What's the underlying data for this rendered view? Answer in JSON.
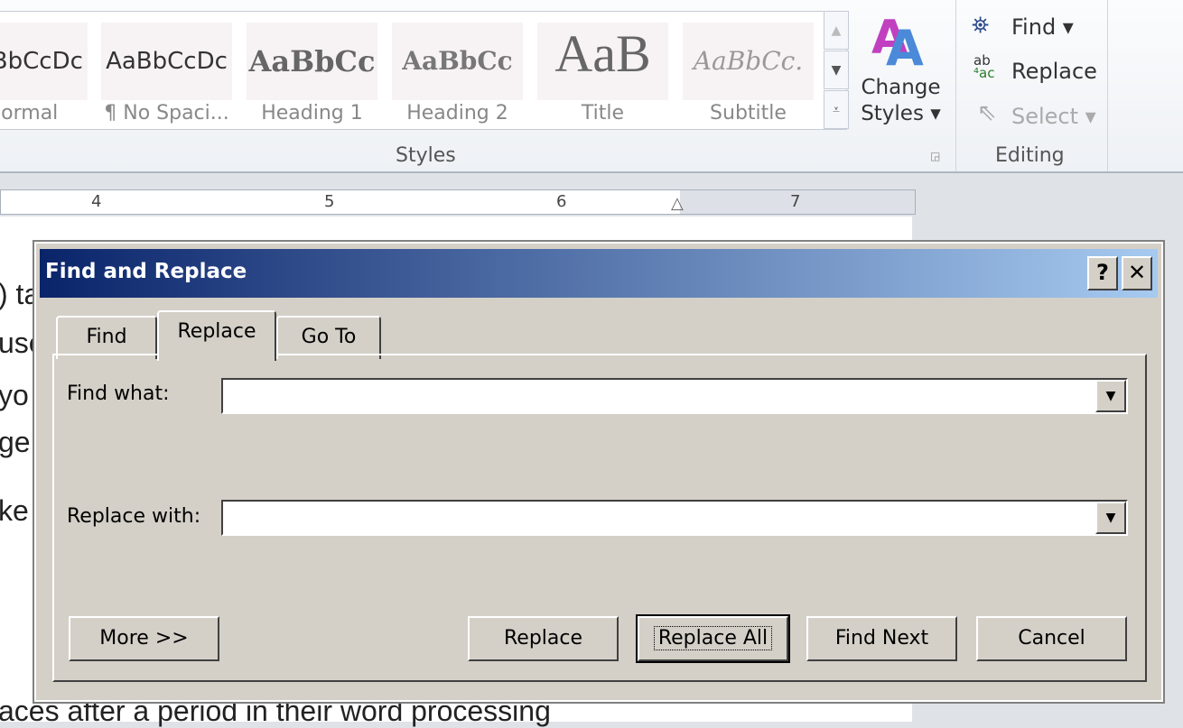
{
  "ribbon": {
    "styles": [
      {
        "preview": "AaBbCcDc",
        "name": "Normal"
      },
      {
        "preview": "AaBbCcDc",
        "name": "¶ No Spaci..."
      },
      {
        "preview": "AaBbCc",
        "name": "Heading 1"
      },
      {
        "preview": "AaBbCc",
        "name": "Heading 2"
      },
      {
        "preview": "AaB",
        "name": "Title"
      },
      {
        "preview": "AaBbCc.",
        "name": "Subtitle"
      }
    ],
    "styles_group": "Styles",
    "change_styles": [
      "Change",
      "Styles ▾"
    ],
    "editing": {
      "find": "Find ▾",
      "replace": "Replace",
      "select": "Select ▾",
      "group": "Editing"
    }
  },
  "ruler": {
    "numbers": [
      "4",
      "5",
      "6",
      "7"
    ]
  },
  "document": {
    "fragments": [
      ") ta",
      "use",
      "yo",
      "ge",
      "ke",
      "aces after a period in their word processing"
    ]
  },
  "dialog": {
    "title": "Find and Replace",
    "help": "?",
    "close": "✕",
    "tabs": [
      {
        "label": "Find"
      },
      {
        "label": "Replace",
        "active": true
      },
      {
        "label": "Go To"
      }
    ],
    "find_what_label": "Find what:",
    "find_what_value": "",
    "replace_with_label": "Replace with:",
    "replace_with_value": "",
    "buttons": {
      "more": "More >>",
      "replace": "Replace",
      "replace_all": "Replace All",
      "find_next": "Find Next",
      "cancel": "Cancel"
    }
  }
}
